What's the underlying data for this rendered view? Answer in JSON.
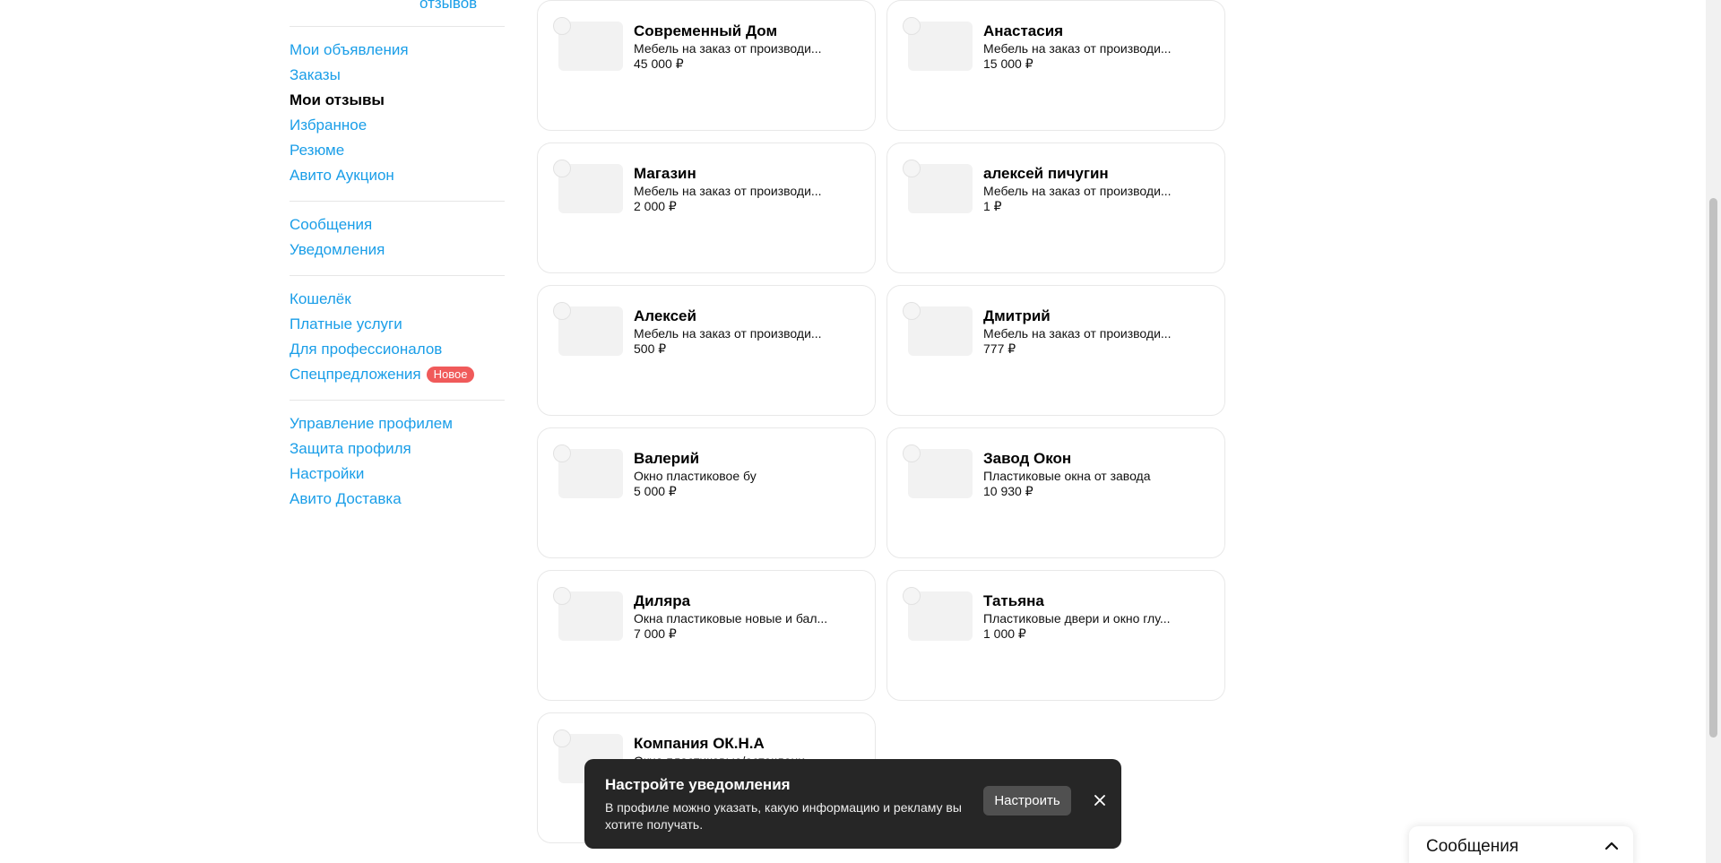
{
  "sidebar": {
    "rating_link": "отзывов",
    "groups": [
      {
        "items": [
          {
            "label": "Мои объявления"
          },
          {
            "label": "Заказы"
          },
          {
            "label": "Мои отзывы",
            "active": true
          },
          {
            "label": "Избранное"
          },
          {
            "label": "Резюме"
          },
          {
            "label": "Авито Аукцион"
          }
        ]
      },
      {
        "items": [
          {
            "label": "Сообщения"
          },
          {
            "label": "Уведомления"
          }
        ]
      },
      {
        "items": [
          {
            "label": "Кошелёк"
          },
          {
            "label": "Платные услуги"
          },
          {
            "label": "Для профессионалов"
          },
          {
            "label": "Спецпредложения",
            "badge": "Новое"
          }
        ]
      },
      {
        "items": [
          {
            "label": "Управление профилем"
          },
          {
            "label": "Защита профиля"
          },
          {
            "label": "Настройки"
          },
          {
            "label": "Авито Доставка"
          }
        ]
      }
    ]
  },
  "cards": [
    {
      "name": "Современный Дом",
      "desc": "Мебель на заказ от производи...",
      "price": "45 000 ₽"
    },
    {
      "name": "Анастасия",
      "desc": "Мебель на заказ от производи...",
      "price": "15 000 ₽"
    },
    {
      "name": "Магазин",
      "desc": "Мебель на заказ от производи...",
      "price": "2 000 ₽"
    },
    {
      "name": "алексей пичугин",
      "desc": "Мебель на заказ от производи...",
      "price": "1 ₽"
    },
    {
      "name": "Алексей",
      "desc": "Мебель на заказ от производи...",
      "price": "500 ₽"
    },
    {
      "name": "Дмитрий",
      "desc": "Мебель на заказ от производи...",
      "price": "777 ₽"
    },
    {
      "name": "Валерий",
      "desc": "Окно пластиковое бу",
      "price": "5 000 ₽"
    },
    {
      "name": "Завод Окон",
      "desc": "Пластиковые окна от завода",
      "price": "10 930 ₽"
    },
    {
      "name": "Диляра",
      "desc": "Окна пластиковые новые и бал...",
      "price": "7 000 ₽"
    },
    {
      "name": "Татьяна",
      "desc": "Пластиковые двери и окно глу...",
      "price": "1 000 ₽"
    },
    {
      "name": "Компания ОК.Н.А",
      "desc": "Окна пластиковые/остеклени...",
      "price": ""
    }
  ],
  "toast": {
    "title": "Настройте уведомления",
    "text": "В профиле можно указать, какую информацию и рекламу вы хотите получать.",
    "button": "Настроить",
    "close_icon": "close-icon"
  },
  "messenger": {
    "title": "Сообщения",
    "chevron_icon": "chevron-up-icon"
  },
  "colors": {
    "link": "#1a9ee8",
    "badge": "#f05a5a",
    "toast_bg": "#262626"
  }
}
